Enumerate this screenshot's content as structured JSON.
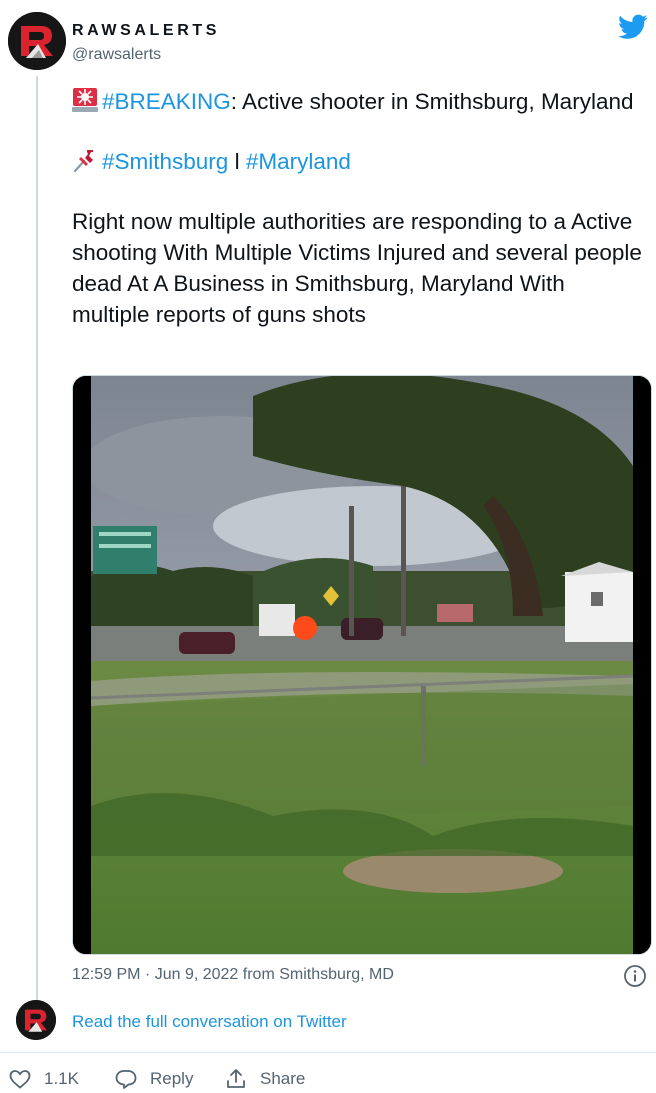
{
  "account": {
    "display_name": "RAWSALERTS",
    "handle": "@rawsalerts",
    "avatar_icon": "rawsalerts-logo-icon",
    "verified_platform_icon": "twitter-bird-icon"
  },
  "tweet": {
    "line1": {
      "emoji": "rotating-light-emoji",
      "hashtag": "#BREAKING",
      "text": ": Active shooter in Smithsburg, Maryland"
    },
    "line2": {
      "emoji": "pushpin-emoji",
      "hashtag1": "#Smithsburg",
      "separator": " l ",
      "hashtag2": "#Maryland"
    },
    "body": "Right now multiple authorities are responding to a Active shooting With Multiple Victims Injured and several people dead At A Business in  Smithsburg, Maryland With multiple reports of guns shots"
  },
  "media": {
    "type": "video-still",
    "description_icon": "video-thumbnail"
  },
  "meta": {
    "timestamp": "12:59 PM · Jun 9, 2022 from Smithsburg, MD",
    "info_icon": "info-icon"
  },
  "conversation": {
    "link_text": "Read the full conversation on Twitter"
  },
  "actions": {
    "like_count": "1.1K",
    "reply_label": "Reply",
    "share_label": "Share"
  },
  "colors": {
    "link_blue": "#1b95e0",
    "twitter_blue": "#1d9bf0",
    "muted_text": "#536471",
    "brand_red": "#d9232e"
  }
}
